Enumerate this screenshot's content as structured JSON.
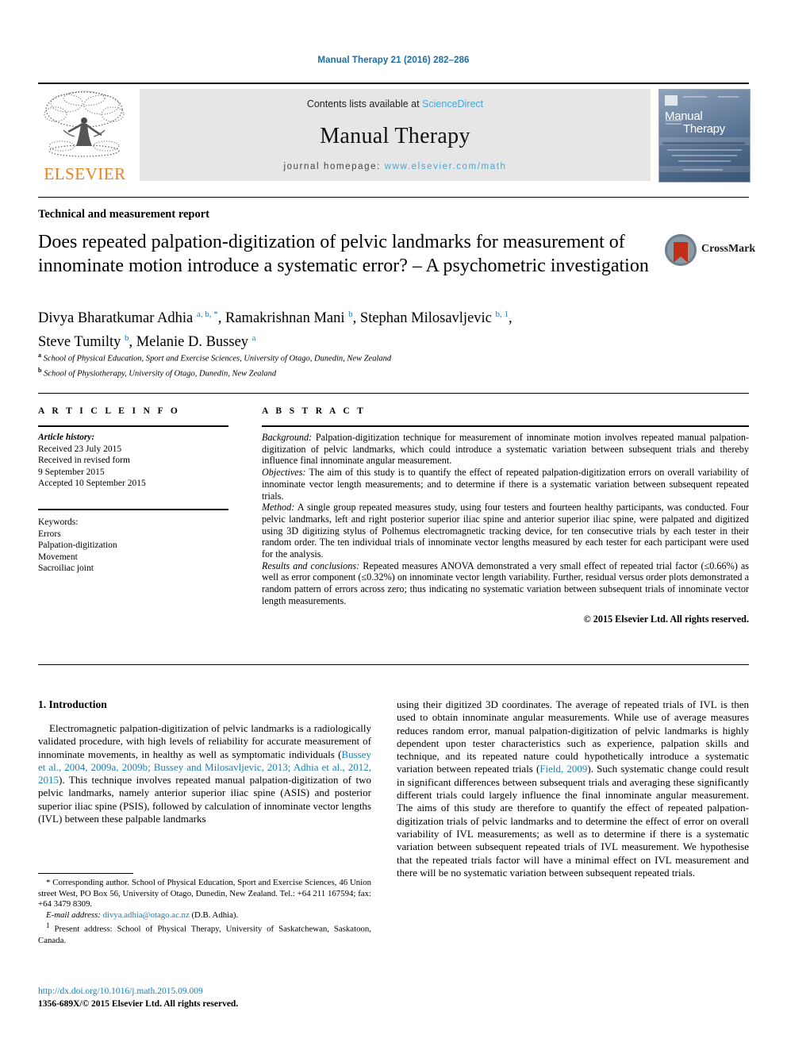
{
  "running_head": "Manual Therapy 21 (2016) 282–286",
  "masthead": {
    "contents_prefix": "Contents lists available at ",
    "sciencedirect": "ScienceDirect",
    "journal_name": "Manual Therapy",
    "homepage_prefix": "journal homepage: ",
    "homepage_url": "www.elsevier.com/math",
    "publisher_wordmark": "ELSEVIER",
    "cover_title_line1": "Manual",
    "cover_title_line2": "Therapy",
    "link_color": "#3fa9dd",
    "elsevier_orange": "#e8801e"
  },
  "article": {
    "type": "Technical and measurement report",
    "title": "Does repeated palpation-digitization of pelvic landmarks for measurement of innominate motion introduce a systematic error? – A psychometric investigation",
    "crossmark_label": "CrossMark",
    "authors_line1_a": "Divya Bharatkumar Adhia ",
    "authors_sup1": "a, b, *",
    "authors_line1_b": ", Ramakrishnan Mani ",
    "authors_sup2": "b",
    "authors_line1_c": ", Stephan Milosavljevic ",
    "authors_sup3": "b, 1",
    "authors_line1_d": ",",
    "authors_line2_a": "Steve Tumilty ",
    "authors_sup4": "b",
    "authors_line2_b": ", Melanie D. Bussey ",
    "authors_sup5": "a",
    "affiliation_a_marker": "a",
    "affiliation_a": " School of Physical Education, Sport and Exercise Sciences, University of Otago, Dunedin, New Zealand",
    "affiliation_b_marker": "b",
    "affiliation_b": " School of Physiotherapy, University of Otago, Dunedin, New Zealand"
  },
  "info": {
    "heading": "A R T I C L E   I N F O",
    "history_label": "Article history:",
    "history": [
      "Received 23 July 2015",
      "Received in revised form",
      "9 September 2015",
      "Accepted 10 September 2015"
    ],
    "keywords_label": "Keywords:",
    "keywords": [
      "Errors",
      "Palpation-digitization",
      "Movement",
      "Sacroiliac joint"
    ]
  },
  "abstract": {
    "heading": "A B S T R A C T",
    "background_label": "Background:",
    "background": " Palpation-digitization technique for measurement of innominate motion involves repeated manual palpation-digitization of pelvic landmarks, which could introduce a systematic variation between subsequent trials and thereby influence final innominate angular measurement.",
    "objectives_label": "Objectives:",
    "objectives": " The aim of this study is to quantify the effect of repeated palpation-digitization errors on overall variability of innominate vector length measurements; and to determine if there is a systematic variation between subsequent repeated trials.",
    "method_label": "Method:",
    "method": " A single group repeated measures study, using four testers and fourteen healthy participants, was conducted. Four pelvic landmarks, left and right posterior superior iliac spine and anterior superior iliac spine, were palpated and digitized using 3D digitizing stylus of Polhemus electromagnetic tracking device, for ten consecutive trials by each tester in their random order. The ten individual trials of innominate vector lengths measured by each tester for each participant were used for the analysis.",
    "results_label": "Results and conclusions:",
    "results": " Repeated measures ANOVA demonstrated a very small effect of repeated trial factor (≤0.66%) as well as error component (≤0.32%) on innominate vector length variability. Further, residual versus order plots demonstrated a random pattern of errors across zero; thus indicating no systematic variation between subsequent trials of innominate vector length measurements.",
    "copyright": "© 2015 Elsevier Ltd. All rights reserved."
  },
  "body": {
    "section_title": "1. Introduction",
    "left_p1_part1": "Electromagnetic palpation-digitization of pelvic landmarks is a radiologically validated procedure, with high levels of reliability for accurate measurement of innominate movements, in healthy as well as symptomatic individuals (",
    "left_p1_cite": "Bussey et al., 2004, 2009a, 2009b; Bussey and Milosavljevic, 2013; Adhia et al., 2012, 2015",
    "left_p1_part2": "). This technique involves repeated manual palpation-digitization of two pelvic landmarks, namely anterior superior iliac spine (ASIS) and posterior superior iliac spine (PSIS), followed by calculation of innominate vector lengths (IVL) between these palpable landmarks",
    "right_p1_part1": "using their digitized 3D coordinates. The average of repeated trials of IVL is then used to obtain innominate angular measurements. While use of average measures reduces random error, manual palpation-digitization of pelvic landmarks is highly dependent upon tester characteristics such as experience, palpation skills and technique, and its repeated nature could hypothetically introduce a systematic variation between repeated trials (",
    "right_p1_cite": "Field, 2009",
    "right_p1_part2": "). Such systematic change could result in significant differences between subsequent trials and averaging these significantly different trials could largely influence the final innominate angular measurement. The aims of this study are therefore to quantify the effect of repeated palpation-digitization trials of pelvic landmarks and to determine the effect of error on overall variability of IVL measurements; as well as to determine if there is a systematic variation between subsequent repeated trials of IVL measurement. We hypothesise that the repeated trials factor will have a minimal effect on IVL measurement and there will be no systematic variation between subsequent repeated trials."
  },
  "footnotes": {
    "corresponding_marker": "*",
    "corresponding": " Corresponding author. School of Physical Education, Sport and Exercise Sciences, 46 Union street West, PO Box 56, University of Otago, Dunedin, New Zealand. Tel.: +64 211 167594; fax: +64 3479 8309.",
    "email_label": "E-mail address:",
    "email": "divya.adhia@otago.ac.nz",
    "email_suffix": " (D.B. Adhia).",
    "present_marker": "1",
    "present_address": " Present address: School of Physical Therapy, University of Saskatchewan, Saskatoon, Canada.",
    "doi": "http://dx.doi.org/10.1016/j.math.2015.09.009",
    "issn": "1356-689X/© 2015 Elsevier Ltd. All rights reserved."
  }
}
